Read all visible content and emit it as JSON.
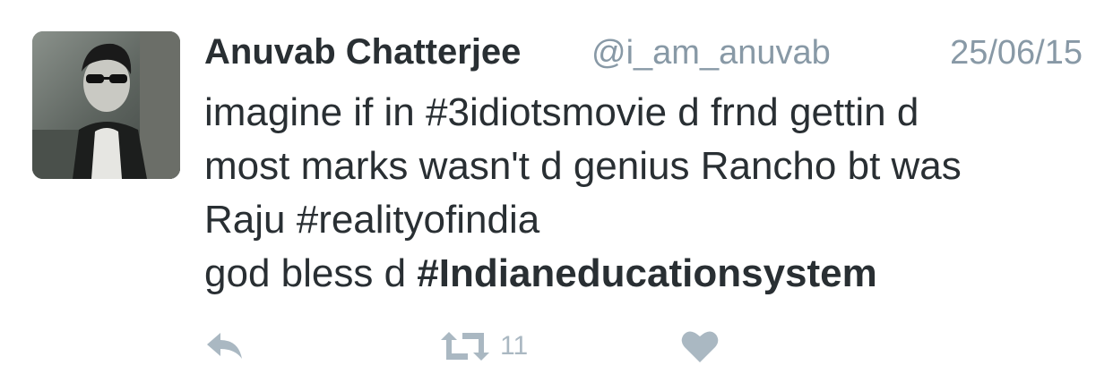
{
  "author": {
    "name": "Anuvab Chatterjee",
    "handle": "@i_am_anuvab"
  },
  "tweet": {
    "date": "25/06/15",
    "lines": [
      "imagine if in #3idiotsmovie d frnd gettin d",
      "most marks wasn't d genius Rancho bt was",
      "Raju #realityofindia"
    ],
    "last_line_prefix": "god bless d ",
    "last_line_hashtag": "#Indianeducationsystem"
  },
  "actions": {
    "reply_icon": "reply-icon",
    "retweet_icon": "retweet-icon",
    "retweet_count": "11",
    "like_icon": "heart-icon"
  },
  "colors": {
    "text": "#292f33",
    "muted": "#8899a6",
    "icon": "#aab8c2"
  }
}
